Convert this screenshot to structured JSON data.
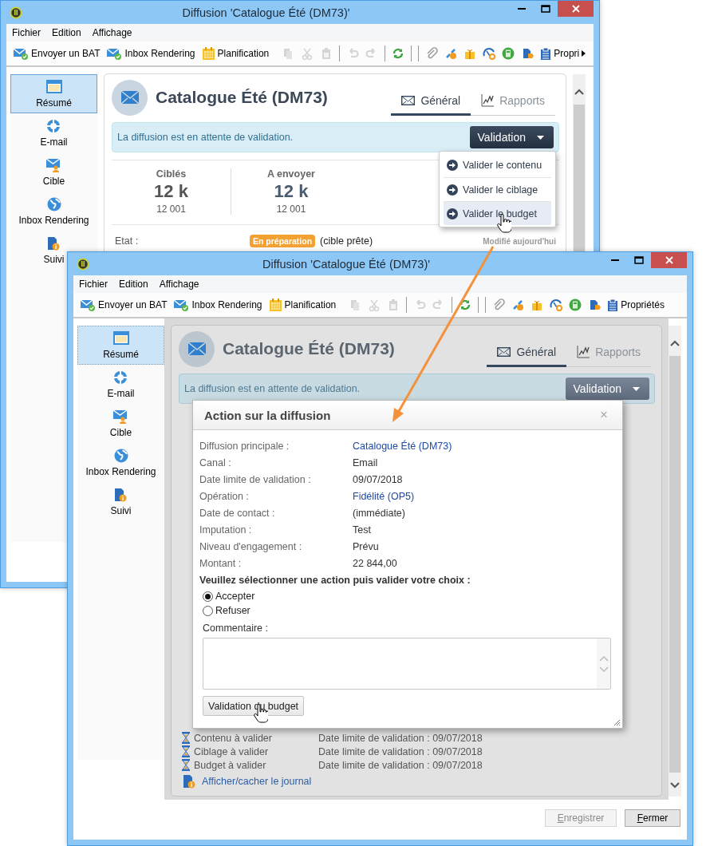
{
  "windows": [
    {
      "title": "Diffusion 'Catalogue Été (DM73)'",
      "menu": [
        "Fichier",
        "Edition",
        "Affichage"
      ],
      "toolbar": {
        "buttons": [
          {
            "label": "Envoyer un BAT"
          },
          {
            "label": "Inbox Rendering"
          },
          {
            "label": "Planification"
          }
        ],
        "tools": [
          {
            "disabled": true
          },
          {
            "disabled": true
          },
          {
            "disabled": true
          },
          {
            "disabled": true
          },
          {
            "disabled": true
          },
          {
            "disabled": false
          },
          {
            "disabled": false
          },
          {
            "disabled": false
          },
          {
            "disabled": false
          },
          {
            "disabled": false
          },
          {
            "disabled": false
          },
          {
            "disabled": false
          }
        ],
        "end_button": {
          "label": "Propri",
          "overflow": true
        }
      },
      "sidebar": [
        {
          "label": "Résumé",
          "selected": true
        },
        {
          "label": "E-mail",
          "selected": false
        },
        {
          "label": "Cible",
          "selected": false
        },
        {
          "label": "Inbox Rendering",
          "selected": false
        },
        {
          "label": "Suivi",
          "selected": false
        }
      ],
      "card": {
        "title": "Catalogue Été (DM73)",
        "tabs": [
          {
            "label": "Général",
            "selected": true
          },
          {
            "label": "Rapports",
            "selected": false
          }
        ],
        "banner": "La diffusion est en attente de validation.",
        "action_button": "Validation",
        "action_menu": [
          {
            "label": "Valider le contenu",
            "highlighted": false
          },
          {
            "label": "Valider le ciblage",
            "highlighted": false
          },
          {
            "label": "Valider le budget",
            "highlighted": true
          }
        ],
        "stats": [
          {
            "label": "Ciblés",
            "value": "12 k",
            "count": "12 001"
          },
          {
            "label": "A envoyer",
            "value": "12 k",
            "count": "12 001"
          }
        ],
        "status": {
          "label": "Etat :",
          "badge": "En préparation",
          "value": "(cible prête)",
          "note": "Modifié aujourd'hui"
        }
      }
    },
    {
      "title": "Diffusion 'Catalogue Été (DM73)'",
      "menu": [
        "Fichier",
        "Edition",
        "Affichage"
      ],
      "toolbar": {
        "buttons": [
          {
            "label": "Envoyer un BAT"
          },
          {
            "label": "Inbox Rendering"
          },
          {
            "label": "Planification"
          }
        ],
        "tools": [
          {
            "disabled": true
          },
          {
            "disabled": true
          },
          {
            "disabled": true
          },
          {
            "disabled": true
          },
          {
            "disabled": true
          },
          {
            "disabled": false
          },
          {
            "disabled": false
          },
          {
            "disabled": false
          },
          {
            "disabled": false
          },
          {
            "disabled": false
          },
          {
            "disabled": false
          },
          {
            "disabled": false
          }
        ],
        "end_button": {
          "label": "Propriétés",
          "overflow": false
        }
      },
      "sidebar": [
        {
          "label": "Résumé",
          "selected": true
        },
        {
          "label": "E-mail",
          "selected": false
        },
        {
          "label": "Cible",
          "selected": false
        },
        {
          "label": "Inbox Rendering",
          "selected": false
        },
        {
          "label": "Suivi",
          "selected": false
        }
      ],
      "card": {
        "title": "Catalogue Été (DM73)",
        "tabs": [
          {
            "label": "Général",
            "selected": true
          },
          {
            "label": "Rapports",
            "selected": false
          }
        ],
        "banner": "La diffusion est en attente de validation.",
        "action_button": "Validation",
        "tasks": [
          {
            "label": "Contenu à valider",
            "deadline": "Date limite de validation : 09/07/2018"
          },
          {
            "label": "Ciblage à valider",
            "deadline": "Date limite de validation : 09/07/2018"
          },
          {
            "label": "Budget à valider",
            "deadline": "Date limite de validation : 09/07/2018"
          }
        ],
        "journal_link": "Afficher/cacher le journal"
      },
      "dialog": {
        "title": "Action sur la diffusion",
        "close": "×",
        "fields": [
          {
            "label": "Diffusion principale :",
            "value": "Catalogue Été (DM73)",
            "link": true
          },
          {
            "label": "Canal :",
            "value": "Email",
            "link": false
          },
          {
            "label": "Date limite de validation :",
            "value": "09/07/2018",
            "link": false
          },
          {
            "label": "Opération :",
            "value": "Fidélité (OP5)",
            "link": true
          },
          {
            "label": "Date de contact :",
            "value": "(immédiate)",
            "link": false
          },
          {
            "label": "Imputation :",
            "value": "Test",
            "link": false
          },
          {
            "label": "Niveau d'engagement :",
            "value": "Prévu",
            "link": false
          },
          {
            "label": "Montant :",
            "value": "22 844,00",
            "link": false
          }
        ],
        "prompt": "Veuillez sélectionner une action puis valider votre choix :",
        "options": [
          {
            "label": "Accepter",
            "selected": true
          },
          {
            "label": "Refuser",
            "selected": false
          }
        ],
        "comment_label": "Commentaire :",
        "submit": "Validation du budget"
      },
      "footer": [
        {
          "label": "Enregistrer",
          "disabled": true
        },
        {
          "label": "Fermer",
          "disabled": false
        }
      ]
    }
  ]
}
